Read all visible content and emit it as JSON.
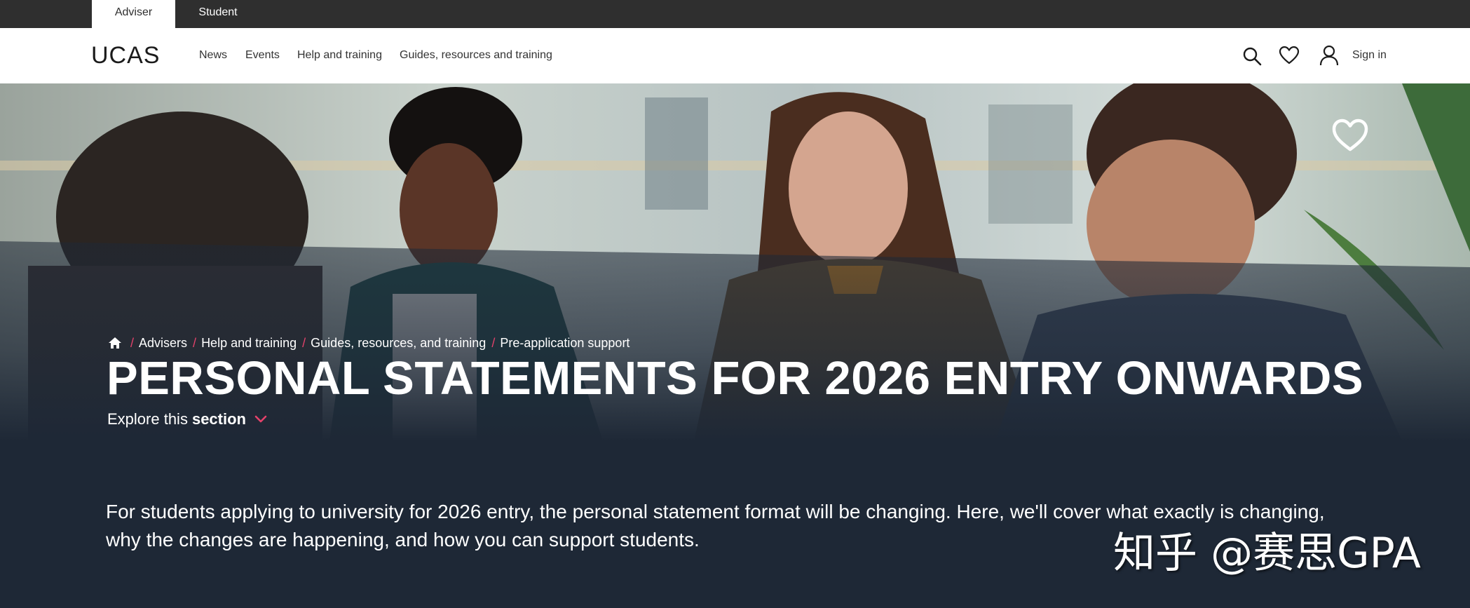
{
  "audience_tabs": {
    "adviser": "Adviser",
    "student": "Student"
  },
  "logo_text": "UCAS",
  "nav": {
    "items": [
      "News",
      "Events",
      "Help and training",
      "Guides, resources and training"
    ],
    "sign_in": "Sign in",
    "icons": [
      "search-icon",
      "heart-icon",
      "user-icon"
    ]
  },
  "breadcrumb": {
    "home_icon": "home-icon",
    "items": [
      "Advisers",
      "Help and training",
      "Guides, resources, and training",
      "Pre-application support"
    ],
    "separator": "/"
  },
  "hero": {
    "title": "PERSONAL STATEMENTS FOR 2026 ENTRY ONWARDS",
    "explore_prefix": "Explore this",
    "explore_bold": "section",
    "favourite_icon": "heart-outline-icon"
  },
  "intro": {
    "line1": "For students applying to university for 2026 entry, the personal statement format will be changing. Here, we'll cover what exactly is changing,",
    "line2": "why the changes are happening, and how you can support students."
  },
  "watermark": "知乎 @赛思GPA",
  "colors": {
    "top_bar": "#2f2f2f",
    "nav_bg": "#ffffff",
    "hero_overlay": "#1e2836",
    "accent_pink": "#e5426b"
  }
}
